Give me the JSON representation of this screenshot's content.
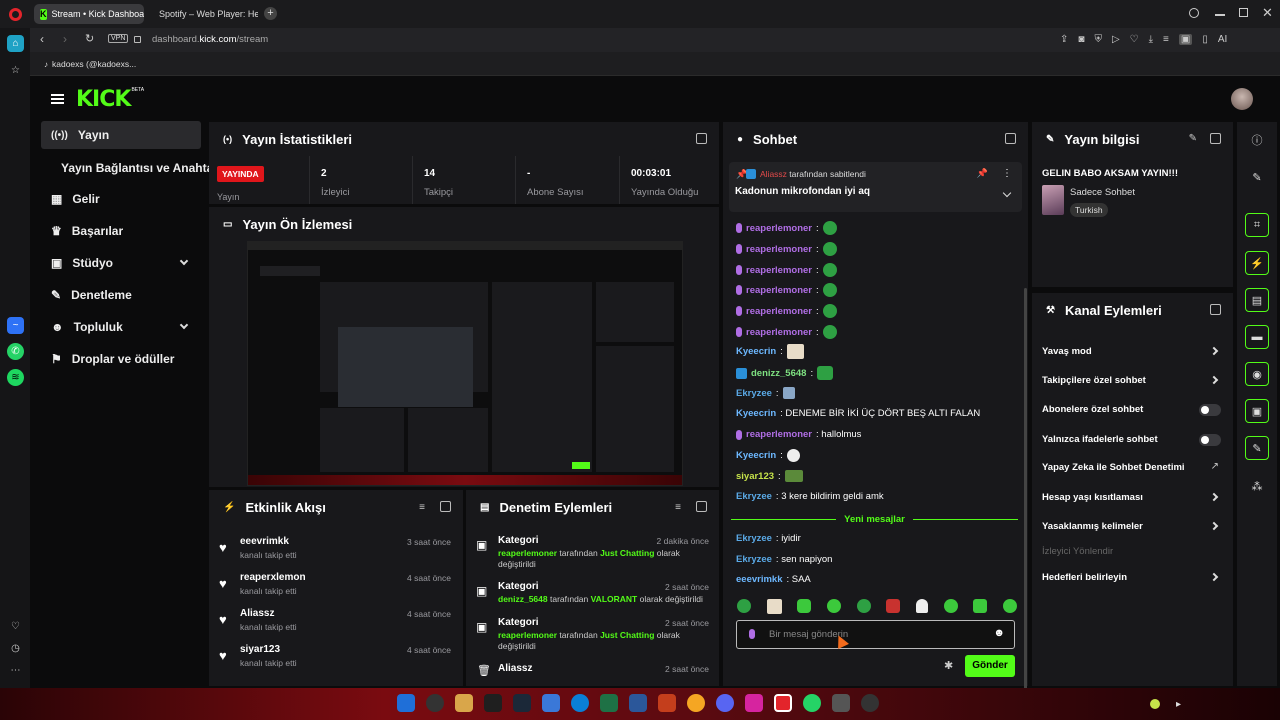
{
  "browser": {
    "tabs": [
      {
        "title": "Stream • Kick Dashboard",
        "active": true
      },
      {
        "title": "Spotify – Web Player: Her",
        "active": false
      }
    ],
    "url_prefix": "dashboard.",
    "url_domain": "kick.com",
    "url_path": "/stream",
    "vpn_label": "VPN",
    "ai_label": "AI",
    "bookmark": "kadoexs (@kadoexs..."
  },
  "kick": {
    "logo": "KICK",
    "logo_badge": "BETA",
    "nav": [
      {
        "label": "Yayın",
        "icon": "broadcast-icon",
        "active": true
      },
      {
        "label": "Yayın Bağlantısı ve Anahtarı",
        "icon": "",
        "active": false
      },
      {
        "label": "Gelir",
        "icon": "revenue-icon",
        "active": false
      },
      {
        "label": "Başarılar",
        "icon": "trophy-icon",
        "active": false
      },
      {
        "label": "Stüdyo",
        "icon": "studio-icon",
        "active": false
      },
      {
        "label": "Denetleme",
        "icon": "wrench-icon",
        "active": false
      },
      {
        "label": "Topluluk",
        "icon": "community-icon",
        "active": false
      },
      {
        "label": "Droplar ve ödüller",
        "icon": "drops-icon",
        "active": false
      }
    ],
    "stats": {
      "title": "Yayın İstatistikleri",
      "live_badge": "YAYINDA",
      "live_label": "Yayın",
      "items": [
        {
          "value": "2",
          "label": "İzleyici"
        },
        {
          "value": "14",
          "label": "Takipçi"
        },
        {
          "value": "-",
          "label": "Abone Sayısı"
        },
        {
          "value": "00:03:01",
          "label": "Yayında Olduğu"
        }
      ]
    },
    "preview": {
      "title": "Yayın Ön İzlemesi"
    },
    "activity": {
      "title": "Etkinlik Akışı",
      "items": [
        {
          "user": "eeevrimkk",
          "text": "kanalı takip etti",
          "time": "3 saat önce"
        },
        {
          "user": "reaperxlemon",
          "text": "kanalı takip etti",
          "time": "4 saat önce"
        },
        {
          "user": "Aliassz",
          "text": "kanalı takip etti",
          "time": "4 saat önce"
        },
        {
          "user": "siyar123",
          "text": "kanalı takip etti",
          "time": "4 saat önce"
        }
      ]
    },
    "moderation": {
      "title": "Denetim Eylemleri",
      "items": [
        {
          "title": "Kategori",
          "time": "2 dakika önce",
          "actor": "reaperlemoner",
          "mid": " tarafından ",
          "category": "Just Chatting",
          "tail": " olarak değiştirildi"
        },
        {
          "title": "Kategori",
          "time": "2 saat önce",
          "actor": "denizz_5648",
          "mid": " tarafından ",
          "category": "VALORANT",
          "tail": " olarak değiştirildi"
        },
        {
          "title": "Kategori",
          "time": "2 saat önce",
          "actor": "reaperlemoner",
          "mid": " tarafından ",
          "category": "Just Chatting",
          "tail": " olarak değiştirildi"
        },
        {
          "title": "Aliassz",
          "time": "2 saat önce",
          "actor": "",
          "mid": "",
          "category": "",
          "tail": ""
        }
      ]
    },
    "chat": {
      "title": "Sohbet",
      "pinned_by_user": "Aliassz",
      "pinned_by_text": " tarafından sabitlendi",
      "pinned_message": "Kadonun mikrofondan iyi aq",
      "messages": [
        {
          "user": "reaperlemoner",
          "text": ":",
          "color": "#b06ee5",
          "badge": "mic"
        },
        {
          "user": "reaperlemoner",
          "text": ":",
          "color": "#b06ee5",
          "badge": "mic"
        },
        {
          "user": "reaperlemoner",
          "text": ":",
          "color": "#b06ee5",
          "badge": "mic"
        },
        {
          "user": "reaperlemoner",
          "text": ":",
          "color": "#b06ee5",
          "badge": "mic"
        },
        {
          "user": "reaperlemoner",
          "text": ":",
          "color": "#b06ee5",
          "badge": "mic"
        },
        {
          "user": "reaperlemoner",
          "text": ":",
          "color": "#b06ee5",
          "badge": "mic"
        },
        {
          "user": "Kyeecrin",
          "text": ":",
          "color": "#6db8ff",
          "badge": ""
        },
        {
          "user": "denizz_5648",
          "text": ":",
          "color": "#7ee081",
          "badge": "mod"
        },
        {
          "user": "Ekryzee",
          "text": ":",
          "color": "#5aa9e6",
          "badge": ""
        },
        {
          "user": "Kyeecrin",
          "text": ": DENEME BİR İKİ ÜÇ DÖRT BEŞ ALTI FALAN",
          "color": "#6db8ff",
          "badge": ""
        },
        {
          "user": "reaperlemoner",
          "text": ": hallolmus",
          "color": "#b06ee5",
          "badge": "mic"
        },
        {
          "user": "Kyeecrin",
          "text": ":",
          "color": "#6db8ff",
          "badge": ""
        },
        {
          "user": "siyar123",
          "text": ":",
          "color": "#c6e34a",
          "badge": ""
        },
        {
          "user": "Ekryzee",
          "text": ": 3 kere bildirim geldi amk",
          "color": "#5aa9e6",
          "badge": ""
        }
      ],
      "new_messages_label": "Yeni mesajlar",
      "new_messages": [
        {
          "user": "Ekryzee",
          "text": ": iyidir",
          "color": "#5aa9e6"
        },
        {
          "user": "Ekryzee",
          "text": ": sen napiyon",
          "color": "#5aa9e6"
        },
        {
          "user": "eeevrimkk",
          "text": ": SAA",
          "color": "#6db8ff"
        }
      ],
      "input_placeholder": "Bir mesaj gönderin",
      "send_label": "Gönder"
    },
    "stream_info": {
      "title": "Yayın bilgisi",
      "stream_title": "GELIN BABO AKSAM YAYIN!!!",
      "category": "Sadece Sohbet",
      "tag": "Turkish"
    },
    "channel_actions": {
      "title": "Kanal Eylemleri",
      "items": [
        {
          "label": "Yavaş mod",
          "control": "chevron",
          "muted": false
        },
        {
          "label": "Takipçilere özel sohbet",
          "control": "chevron",
          "muted": false
        },
        {
          "label": "Abonelere özel sohbet",
          "control": "toggle",
          "muted": false
        },
        {
          "label": "Yalnızca ifadelerle sohbet",
          "control": "toggle",
          "muted": false
        },
        {
          "label": "Yapay Zeka ile Sohbet Denetimi",
          "control": "external",
          "muted": false
        },
        {
          "label": "Hesap yaşı kısıtlaması",
          "control": "chevron",
          "muted": false
        },
        {
          "label": "Yasaklanmış kelimeler",
          "control": "chevron",
          "muted": false
        },
        {
          "label": "İzleyici Yönlendir",
          "control": "none",
          "muted": true
        },
        {
          "label": "Hedefleri belirleyin",
          "control": "chevron",
          "muted": false
        }
      ]
    }
  },
  "colors": {
    "kick_green": "#53fc18",
    "panel": "#18181b",
    "bg": "#0b0b0c",
    "live_red": "#e0161b"
  }
}
